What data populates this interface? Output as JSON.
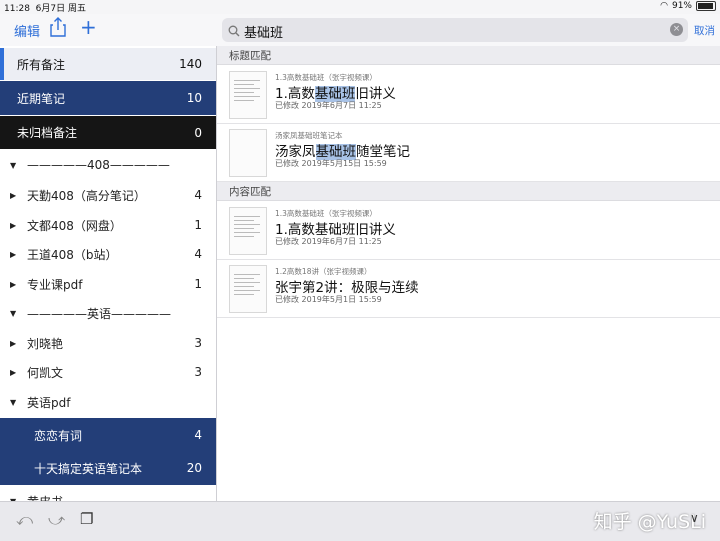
{
  "status_bar": {
    "time": "11:28",
    "date": "6月7日 周五",
    "battery": "91%",
    "battery_level": 0.91
  },
  "toolbar": {
    "edit_label": "编辑",
    "cancel_label": "取消",
    "icons": [
      "share-icon",
      "plus-icon",
      "search-icon",
      "clear-icon"
    ]
  },
  "search": {
    "value": "基础班"
  },
  "sidebar": {
    "items": [
      {
        "label": "所有备注",
        "count": "140",
        "style": "active"
      },
      {
        "label": "近期笔记",
        "count": "10",
        "style": "blue"
      },
      {
        "label": "未归档备注",
        "count": "0",
        "style": "dark"
      },
      {
        "label": "—————408—————",
        "count": "",
        "style": "plain",
        "expanded": true
      },
      {
        "label": "天勤408（高分笔记）",
        "count": "4",
        "style": "plain",
        "expanded": false
      },
      {
        "label": "文都408（网盘）",
        "count": "1",
        "style": "plain",
        "expanded": false
      },
      {
        "label": "王道408（b站）",
        "count": "4",
        "style": "plain",
        "expanded": false
      },
      {
        "label": "专业课pdf",
        "count": "1",
        "style": "plain",
        "expanded": false
      },
      {
        "label": "—————英语—————",
        "count": "",
        "style": "plain",
        "expanded": true
      },
      {
        "label": "刘晓艳",
        "count": "3",
        "style": "plain",
        "expanded": false
      },
      {
        "label": "何凯文",
        "count": "3",
        "style": "plain",
        "expanded": false
      },
      {
        "label": "英语pdf",
        "count": "",
        "style": "plain",
        "expanded": true
      },
      {
        "label": "恋恋有词",
        "count": "4",
        "style": "child"
      },
      {
        "label": "十天搞定英语笔记本",
        "count": "20",
        "style": "child"
      },
      {
        "label": "黄皮书",
        "count": "",
        "style": "plain",
        "expanded": true
      }
    ]
  },
  "results": {
    "title_section": "标题匹配",
    "content_section": "内容匹配",
    "title_matches": [
      {
        "book": "1.3高数基础班（张宇视频课）",
        "title_pre": "1.高数",
        "title_hl": "基础班",
        "title_post": "旧讲义",
        "date": "已修改 2019年6月7日 11:25"
      },
      {
        "book": "汤家凤基础班笔记本",
        "title_pre": "汤家凤",
        "title_hl": "基础班",
        "title_post": "随堂笔记",
        "date": "已修改 2019年5月15日 15:59"
      }
    ],
    "content_matches": [
      {
        "book": "1.3高数基础班（张宇视频课）",
        "title_pre": "1.高数基础班旧讲义",
        "title_hl": "",
        "title_post": "",
        "date": "已修改 2019年6月7日 11:25"
      },
      {
        "book": "1.2高数18讲（张宇视频课）",
        "title_pre": "张宇第2讲：极限与连续",
        "title_hl": "",
        "title_post": "",
        "date": "已修改 2019年5月1日 15:59"
      }
    ]
  },
  "watermark": "知乎 @YuSLi",
  "colors": {
    "accent": "#2f6fd8",
    "sidebar_blue": "#233e78",
    "sidebar_dark": "#151515",
    "highlight": "#a8c2e6"
  }
}
